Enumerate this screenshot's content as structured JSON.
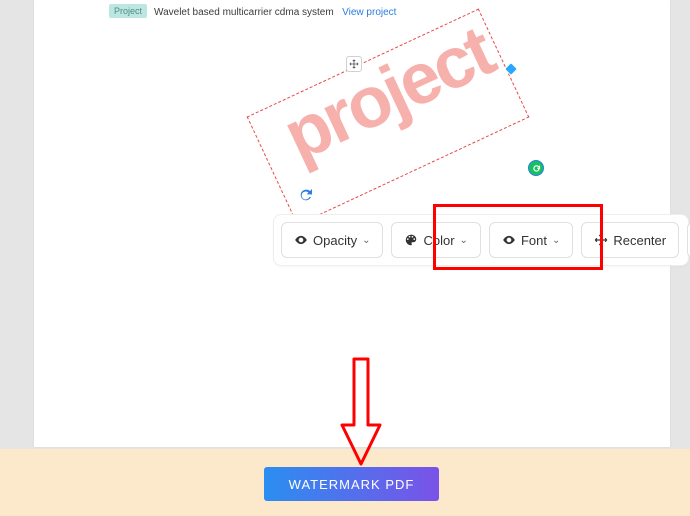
{
  "doc": {
    "badge": "Project",
    "text": "Wavelet based multicarrier cdma system",
    "link": "View project"
  },
  "watermark": {
    "text": "project"
  },
  "toolbar": {
    "opacity_label": "Opacity",
    "color_label": "Color",
    "font_label": "Font",
    "recenter_label": "Recenter"
  },
  "actions": {
    "watermark_pdf": "WATERMARK PDF"
  }
}
